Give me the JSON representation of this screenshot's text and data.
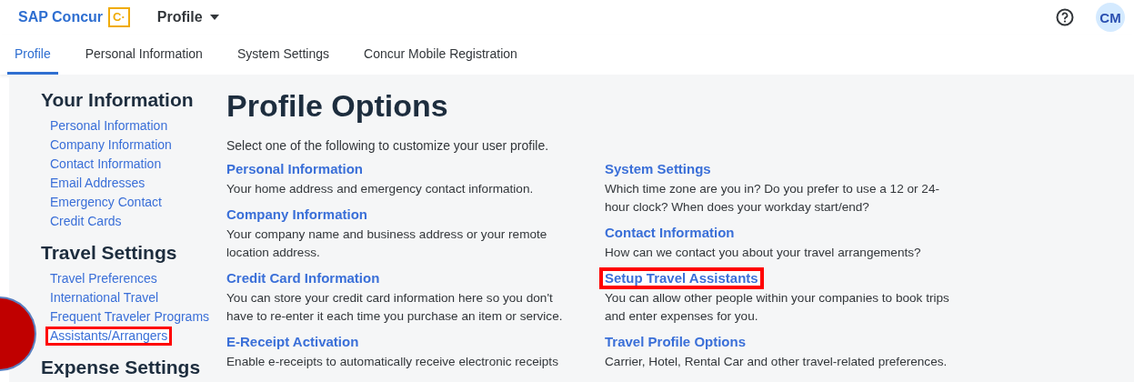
{
  "header": {
    "brand": "SAP Concur",
    "brand_mark": "C·",
    "menu": "Profile",
    "avatar": "CM"
  },
  "tabs": [
    {
      "label": "Profile",
      "selected": true
    },
    {
      "label": "Personal Information",
      "selected": false
    },
    {
      "label": "System Settings",
      "selected": false
    },
    {
      "label": "Concur Mobile Registration",
      "selected": false
    }
  ],
  "sidebar": [
    {
      "heading": "Your Information",
      "items": [
        {
          "label": "Personal Information",
          "highlighted": false
        },
        {
          "label": "Company Information",
          "highlighted": false
        },
        {
          "label": "Contact Information",
          "highlighted": false
        },
        {
          "label": "Email Addresses",
          "highlighted": false
        },
        {
          "label": "Emergency Contact",
          "highlighted": false
        },
        {
          "label": "Credit Cards",
          "highlighted": false
        }
      ]
    },
    {
      "heading": "Travel Settings",
      "items": [
        {
          "label": "Travel Preferences",
          "highlighted": false
        },
        {
          "label": "International Travel",
          "highlighted": false
        },
        {
          "label": "Frequent Traveler Programs",
          "highlighted": false
        },
        {
          "label": "Assistants/Arrangers",
          "highlighted": true
        }
      ]
    },
    {
      "heading": "Expense Settings"
    }
  ],
  "main": {
    "title": "Profile Options",
    "intro": "Select one of the following to customize your user profile.",
    "columns": [
      [
        {
          "title": "Personal Information",
          "description": "Your home address and emergency contact information.",
          "highlighted": false
        },
        {
          "title": "Company Information",
          "description": "Your company name and business address or your remote location address.",
          "highlighted": false
        },
        {
          "title": "Credit Card Information",
          "description": "You can store your credit card information here so you don't have to re-enter it each time you purchase an item or service.",
          "highlighted": false
        },
        {
          "title": "E-Receipt Activation",
          "description": "Enable e-receipts to automatically receive electronic receipts",
          "highlighted": false
        }
      ],
      [
        {
          "title": "System Settings",
          "description": "Which time zone are you in? Do you prefer to use a 12 or 24-hour clock? When does your workday start/end?",
          "highlighted": false
        },
        {
          "title": "Contact Information",
          "description": "How can we contact you about your travel arrangements?",
          "highlighted": false
        },
        {
          "title": "Setup Travel Assistants",
          "description": "You can allow other people within your companies to book trips and enter expenses for you.",
          "highlighted": true
        },
        {
          "title": "Travel Profile Options",
          "description": "Carrier, Hotel, Rental Car and other travel-related preferences.",
          "highlighted": false
        }
      ]
    ]
  }
}
